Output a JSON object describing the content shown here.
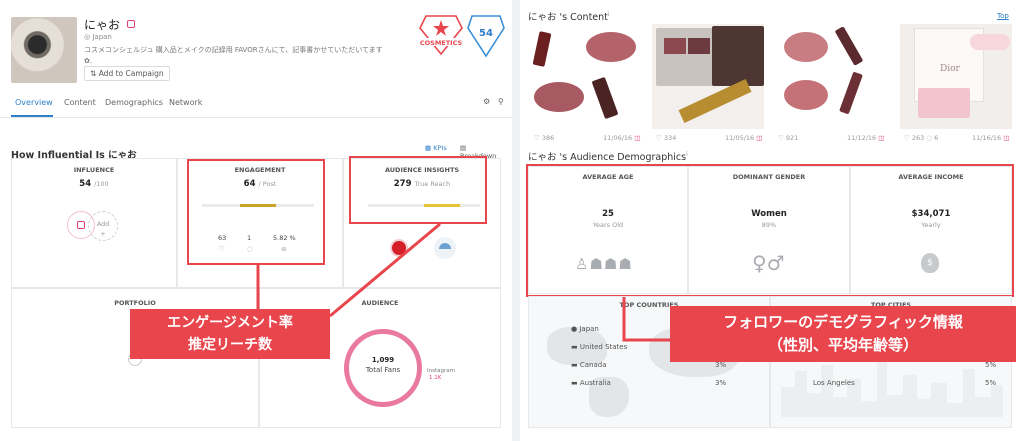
{
  "profile": {
    "name": "にゃお",
    "location": "Japan",
    "bio": "コスメコンシェルジュ 購入品とメイクの記録用 FAVORさんにて、記事書かせていただいてます✿.",
    "add_campaign": "Add to Campaign",
    "category_badge": "COSMETICS",
    "score": "54"
  },
  "tabs": [
    "Overview",
    "Content",
    "Demographics",
    "Network"
  ],
  "influence_section": {
    "title": "How Influential Is にゃお",
    "kpis": "KPIs",
    "breakdown": "Breakdown"
  },
  "influence": {
    "label": "INFLUENCE",
    "value": "54",
    "suffix": "/100",
    "add": "Add"
  },
  "engagement": {
    "label": "ENGAGEMENT",
    "value": "64",
    "suffix": "/ Post",
    "likes": "63",
    "comments": "1",
    "rate": "5.82 %"
  },
  "audience_insights": {
    "label": "AUDIENCE INSIGHTS",
    "value": "279",
    "suffix": "True Reach"
  },
  "portfolio": {
    "label": "PORTFOLIO"
  },
  "audience": {
    "label": "AUDIENCE",
    "total": "1,099",
    "total_label": "Total Fans",
    "network": "Instagram",
    "network_value": "1.1K"
  },
  "callout_left": {
    "line1": "エンゲージメント率",
    "line2": "推定リーチ数"
  },
  "content": {
    "title": "にゃお 's Content",
    "top_link": "Top",
    "posts": [
      {
        "likes": "386",
        "date": "11/06/16"
      },
      {
        "likes": "334",
        "date": "11/05/16"
      },
      {
        "likes": "921",
        "date": "11/12/16"
      },
      {
        "likes": "263",
        "comments": "6",
        "date": "11/16/16"
      }
    ]
  },
  "demographics": {
    "title": "にゃお 's Audience Demographics",
    "age": {
      "label": "AVERAGE AGE",
      "value": "25",
      "sub": "Years Old"
    },
    "gender": {
      "label": "DOMINANT GENDER",
      "value": "Women",
      "sub": "89%"
    },
    "income": {
      "label": "AVERAGE INCOME",
      "value": "$34,071",
      "sub": "Yearly"
    }
  },
  "top_countries": {
    "label": "TOP COUNTRIES",
    "rows": [
      {
        "name": "Japan",
        "pct": ""
      },
      {
        "name": "United States",
        "pct": ""
      },
      {
        "name": "Canada",
        "pct": "3%"
      },
      {
        "name": "Australia",
        "pct": "3%"
      }
    ]
  },
  "top_cities": {
    "label": "TOP CITIES",
    "rows": [
      {
        "name": "Los Angeles",
        "pct": "5%"
      },
      {
        "name": "",
        "pct": "5%"
      }
    ]
  },
  "callout_right": {
    "line1": "フォロワーのデモグラフィック情報",
    "line2": "（性別、平均年齢等）"
  },
  "colors": {
    "accent_red": "#e8454c",
    "link_blue": "#2e7ec8",
    "bar_gold": "#c9a227",
    "insight_yellow": "#e9c237"
  },
  "engagement_bar_fraction": 0.5,
  "insight_bar_fraction": 0.66
}
